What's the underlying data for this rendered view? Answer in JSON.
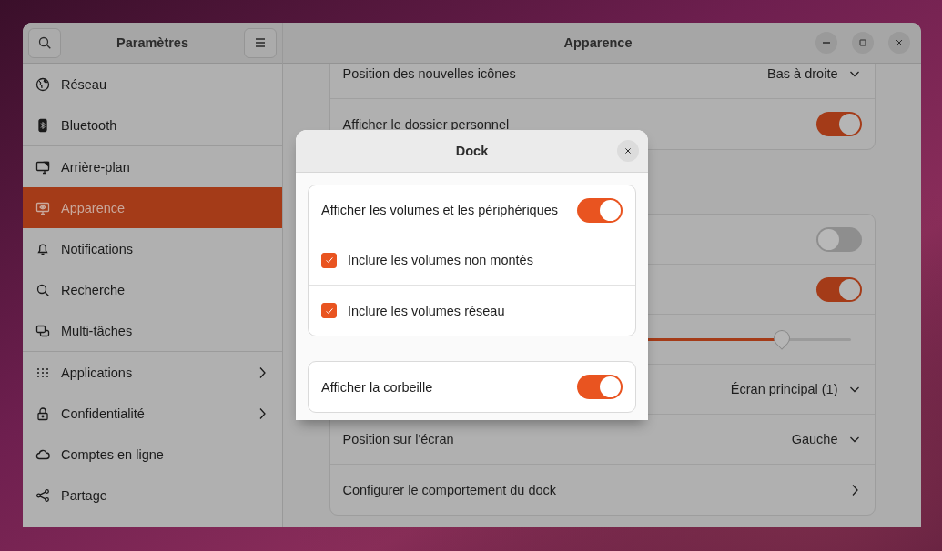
{
  "window": {
    "sidebar_title": "Paramètres",
    "title": "Apparence"
  },
  "sidebar": {
    "groups": [
      {
        "items": [
          {
            "label": "Réseau",
            "selected": false,
            "chevron": false
          },
          {
            "label": "Bluetooth",
            "selected": false,
            "chevron": false
          }
        ]
      },
      {
        "items": [
          {
            "label": "Arrière-plan",
            "selected": false,
            "chevron": false
          },
          {
            "label": "Apparence",
            "selected": true,
            "chevron": false
          },
          {
            "label": "Notifications",
            "selected": false,
            "chevron": false
          },
          {
            "label": "Recherche",
            "selected": false,
            "chevron": false
          },
          {
            "label": "Multi-tâches",
            "selected": false,
            "chevron": false
          }
        ]
      },
      {
        "items": [
          {
            "label": "Applications",
            "selected": false,
            "chevron": true
          },
          {
            "label": "Confidentialité",
            "selected": false,
            "chevron": true
          },
          {
            "label": "Comptes en ligne",
            "selected": false,
            "chevron": false
          },
          {
            "label": "Partage",
            "selected": false,
            "chevron": false
          }
        ]
      }
    ]
  },
  "panels": [
    {
      "rows": [
        {
          "kind": "dropdown",
          "label": "Position des nouvelles icônes",
          "value": "Bas à droite"
        },
        {
          "kind": "toggle",
          "label": "Afficher le dossier personnel",
          "on": true
        }
      ]
    },
    {
      "rows": [
        {
          "kind": "toggle",
          "on": false
        },
        {
          "kind": "toggle",
          "on": true
        },
        {
          "kind": "slider",
          "level": 0.79
        },
        {
          "kind": "dropdown",
          "value": "Écran principal (1)"
        },
        {
          "kind": "dropdown",
          "label": "Position sur l'écran",
          "value": "Gauche"
        },
        {
          "kind": "link",
          "label": "Configurer le comportement du dock"
        }
      ]
    }
  ],
  "dialog": {
    "title": "Dock",
    "groups": [
      {
        "rows": [
          {
            "kind": "toggle",
            "label": "Afficher les volumes et les périphériques",
            "on": true
          },
          {
            "kind": "checkbox",
            "label": "Inclure les volumes non montés",
            "checked": true
          },
          {
            "kind": "checkbox",
            "label": "Inclure les volumes réseau",
            "checked": true
          }
        ]
      },
      {
        "rows": [
          {
            "kind": "toggle",
            "label": "Afficher la corbeille",
            "on": true
          }
        ]
      }
    ]
  }
}
